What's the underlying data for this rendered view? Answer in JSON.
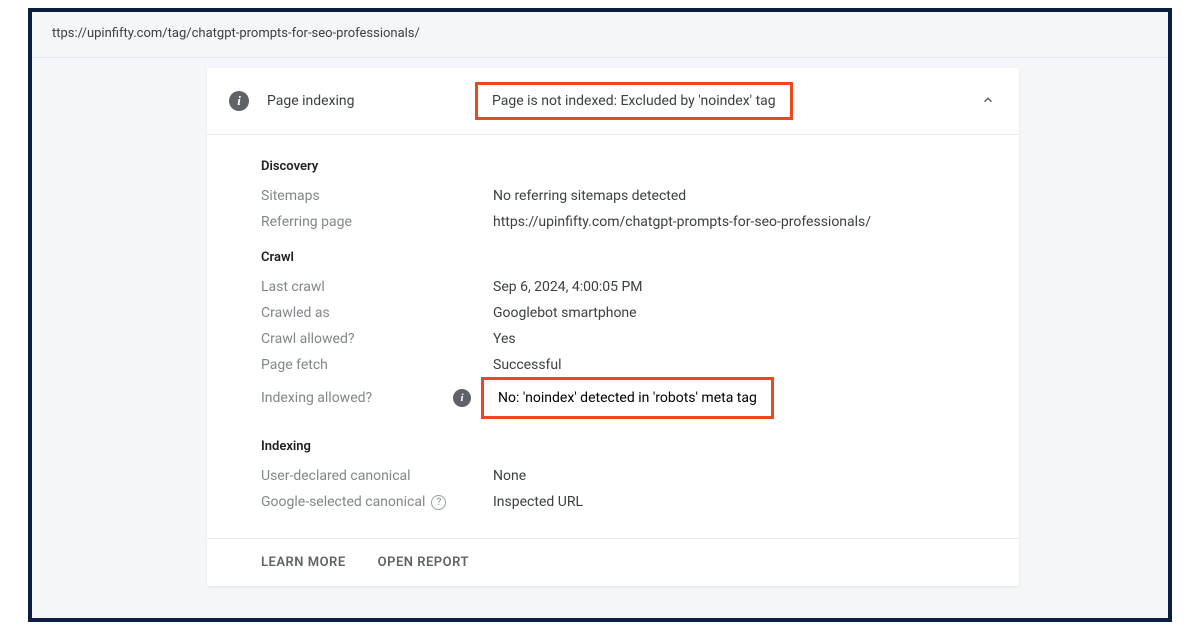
{
  "url_display": "ttps://upinfifty.com/tag/chatgpt-prompts-for-seo-professionals/",
  "card": {
    "header_title": "Page indexing",
    "header_status": "Page is not indexed: Excluded by 'noindex' tag"
  },
  "sections": {
    "discovery": {
      "title": "Discovery",
      "sitemaps_label": "Sitemaps",
      "sitemaps_value": "No referring sitemaps detected",
      "referring_label": "Referring page",
      "referring_value": "https://upinfifty.com/chatgpt-prompts-for-seo-professionals/"
    },
    "crawl": {
      "title": "Crawl",
      "last_crawl_label": "Last crawl",
      "last_crawl_value": "Sep 6, 2024, 4:00:05 PM",
      "crawled_as_label": "Crawled as",
      "crawled_as_value": "Googlebot smartphone",
      "crawl_allowed_label": "Crawl allowed?",
      "crawl_allowed_value": "Yes",
      "page_fetch_label": "Page fetch",
      "page_fetch_value": "Successful",
      "indexing_allowed_label": "Indexing allowed?",
      "indexing_allowed_value": "No: 'noindex' detected in 'robots' meta tag"
    },
    "indexing": {
      "title": "Indexing",
      "user_canonical_label": "User-declared canonical",
      "user_canonical_value": "None",
      "google_canonical_label": "Google-selected canonical",
      "google_canonical_value": "Inspected URL"
    }
  },
  "footer": {
    "learn_more": "LEARN MORE",
    "open_report": "OPEN REPORT"
  }
}
